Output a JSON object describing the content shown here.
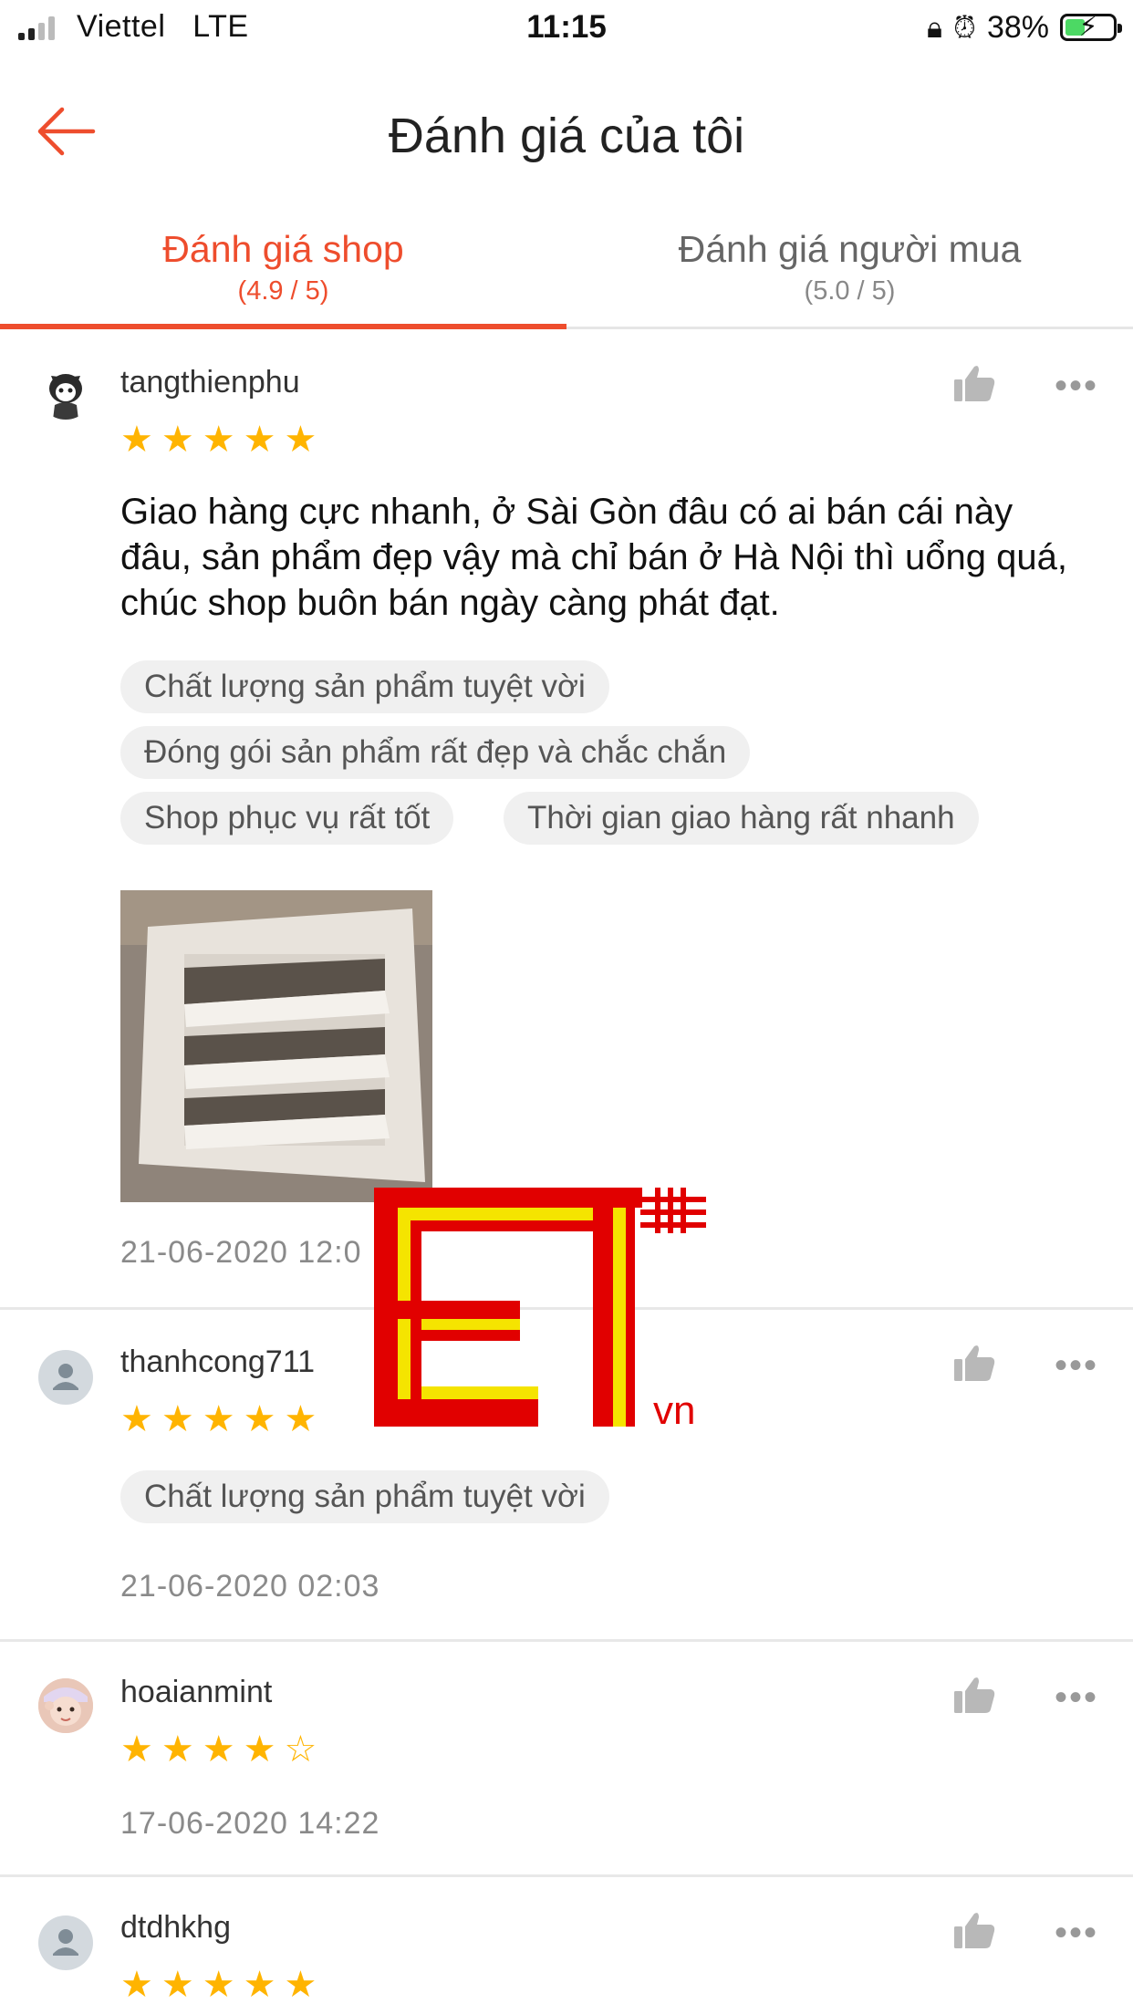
{
  "status_bar": {
    "carrier": "Viettel",
    "network": "LTE",
    "time": "11:15",
    "battery_percent": "38%",
    "battery_level": 0.38,
    "icons": [
      "signal-icon",
      "orientation-lock-icon",
      "alarm-icon",
      "battery-charging-icon"
    ]
  },
  "header": {
    "title": "Đánh giá của tôi",
    "back_icon": "arrow-left-icon"
  },
  "tabs": [
    {
      "label": "Đánh giá shop",
      "rating": "(4.9 / 5)",
      "active": true
    },
    {
      "label": "Đánh giá người mua",
      "rating": "(5.0 / 5)",
      "active": false
    }
  ],
  "reviews": [
    {
      "username": "tangthienphu",
      "rating": 5,
      "comment": "Giao hàng cực nhanh, ở Sài Gòn đâu có ai bán cái này đâu, sản phẩm đẹp vậy mà chỉ bán ở Hà Nội thì uổng quá, chúc shop buôn bán ngày càng phát đạt.",
      "tags": [
        "Chất lượng sản phẩm tuyệt vời",
        "Đóng gói sản phẩm rất đẹp và chắc chắn",
        "Shop phục vụ rất tốt",
        "Thời gian giao hàng rất nhanh"
      ],
      "date": "21-06-2020 12:0"
    },
    {
      "username": "thanhcong711",
      "rating": 5,
      "tags": [
        "Chất lượng sản phẩm tuyệt vời"
      ],
      "date": "21-06-2020 02:03"
    },
    {
      "username": "hoaianmint",
      "rating": 4,
      "date": "17-06-2020 14:22"
    },
    {
      "username": "dtdhkhg",
      "rating": 5
    }
  ],
  "watermark": {
    "suffix": "vn",
    "colors": {
      "red": "#e10000",
      "yellow": "#f5e400"
    }
  },
  "colors": {
    "accent": "#ee4d2d",
    "star": "#ffb400",
    "tag_bg": "#f0f0f0"
  }
}
